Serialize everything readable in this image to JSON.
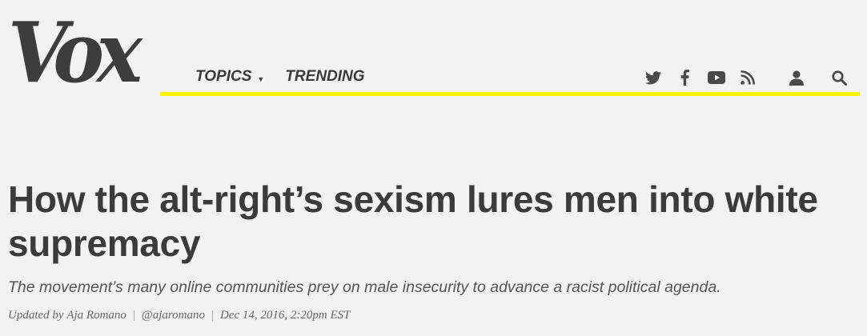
{
  "site": {
    "logo_text": "Vox"
  },
  "nav": {
    "items": [
      {
        "label": "TOPICS",
        "has_dropdown": true
      },
      {
        "label": "TRENDING",
        "has_dropdown": false
      }
    ]
  },
  "social_icons": [
    "twitter-icon",
    "facebook-icon",
    "youtube-icon",
    "rss-icon"
  ],
  "utility_icons": [
    "user-icon",
    "search-icon"
  ],
  "colors": {
    "accent_bar": "#fff200",
    "text": "#3b3b3b",
    "background": "#f2f2f2"
  },
  "article": {
    "headline": "How the alt-right’s sexism lures men into white supremacy",
    "dek": "The movement’s many online communities prey on male insecurity to advance a racist political agenda.",
    "byline": {
      "prefix": "Updated by",
      "author": "Aja Romano",
      "handle": "@ajaromano",
      "timestamp": "Dec 14, 2016, 2:20pm EST"
    }
  }
}
